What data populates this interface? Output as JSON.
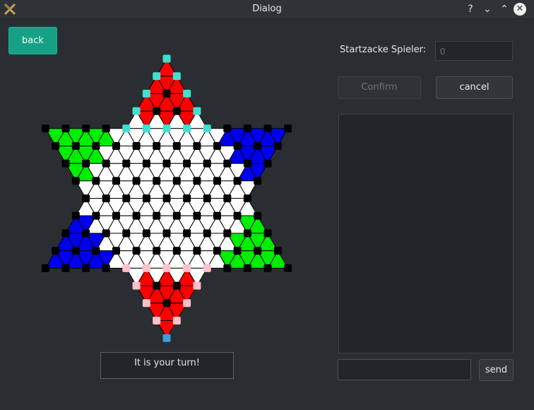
{
  "window": {
    "title": "Dialog",
    "help_glyph": "?",
    "minimize_glyph": "⌄",
    "maximize_glyph": "⌃",
    "close_glyph": "✕"
  },
  "controls": {
    "back_label": "back",
    "start_label": "Startzacke Spieler:",
    "start_placeholder": "0",
    "confirm_label": "Confirm",
    "cancel_label": "cancel",
    "send_label": "send"
  },
  "status": {
    "text": "It is your turn!"
  },
  "board": {
    "colors": {
      "red": "#ff0000",
      "green": "#00ee00",
      "blue": "#0000ee",
      "white": "#ffffff",
      "black": "#000000",
      "cyan": "#40e0d0",
      "pink": "#ffc0cb",
      "lightblue": "#3d9fe0",
      "edge": "#000000"
    }
  }
}
